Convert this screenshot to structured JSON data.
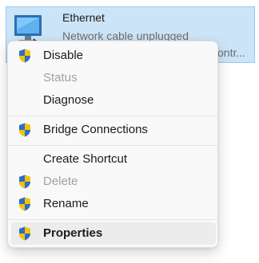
{
  "item": {
    "name": "Ethernet",
    "status": "Network cable unplugged",
    "device": "ontr..."
  },
  "menu": {
    "items": [
      {
        "label": "Disable",
        "shield": true,
        "enabled": true
      },
      {
        "label": "Status",
        "shield": false,
        "enabled": false
      },
      {
        "label": "Diagnose",
        "shield": false,
        "enabled": true
      },
      {
        "label": "Bridge Connections",
        "shield": true,
        "enabled": true
      },
      {
        "label": "Create Shortcut",
        "shield": false,
        "enabled": true
      },
      {
        "label": "Delete",
        "shield": true,
        "enabled": false
      },
      {
        "label": "Rename",
        "shield": true,
        "enabled": true
      },
      {
        "label": "Properties",
        "shield": true,
        "enabled": true,
        "default": true,
        "highlighted": true
      }
    ]
  },
  "colors": {
    "selection_bg": "#cce4f7",
    "menu_bg": "#f9f9f9",
    "disabled_text": "#a0a0a0",
    "hover_bg": "#ececec"
  }
}
